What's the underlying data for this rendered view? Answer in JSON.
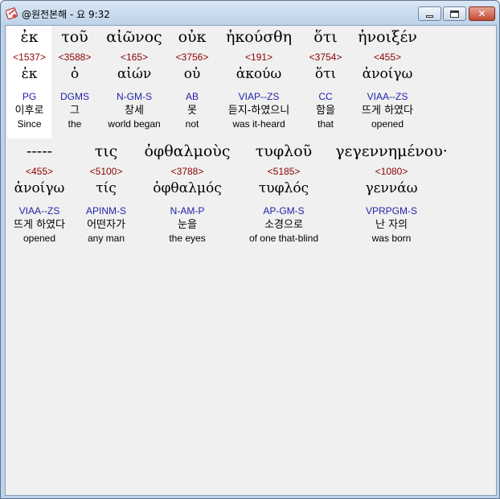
{
  "window": {
    "title": "@원전본해 - 요 9:32",
    "icon": "bible-app-icon",
    "controls": {
      "minimize": "minimize-icon",
      "maximize": "maximize-icon",
      "close": "close-icon",
      "close_glyph": "✕"
    }
  },
  "colors": {
    "strong": "#8b0000",
    "parse": "#2222aa",
    "selected_bg": "#ffffff",
    "client_bg": "#f0f0f0"
  },
  "rows": [
    {
      "words": [
        {
          "greek": "ἐκ",
          "strong": "<1537>",
          "lemma": "ἐκ",
          "parse": "PG",
          "korean": "이후로",
          "english": "Since",
          "selected": true
        },
        {
          "greek": "τοῦ",
          "strong": "<3588>",
          "lemma": "ὁ",
          "parse": "DGMS",
          "korean": "그",
          "english": "the"
        },
        {
          "greek": "αἰῶνος",
          "strong": "<165>",
          "lemma": "αἰών",
          "parse": "N-GM-S",
          "korean": "창세",
          "english": "world began"
        },
        {
          "greek": "οὐκ",
          "strong": "<3756>",
          "lemma": "οὐ",
          "parse": "AB",
          "korean": "못",
          "english": "not"
        },
        {
          "greek": "ἠκούσθη",
          "strong": "<191>",
          "lemma": "ἀκούω",
          "parse": "VIAP--ZS",
          "korean": "듣지-하였으니",
          "english": "was it-heard"
        },
        {
          "greek": "ὅτι",
          "strong": "<3754>",
          "lemma": "ὅτι",
          "parse": "CC",
          "korean": "함을",
          "english": "that"
        },
        {
          "greek": "ἠνοιξέν",
          "strong": "<455>",
          "lemma": "ἀνοίγω",
          "parse": "VIAA--ZS",
          "korean": "뜨게 하였다",
          "english": "opened"
        }
      ]
    },
    {
      "words": [
        {
          "greek": "-----",
          "strong": "<455>",
          "lemma": "ἀνοίγω",
          "parse": "VIAA--ZS",
          "korean": "뜨게 하였다",
          "english": "opened"
        },
        {
          "greek": "τις",
          "strong": "<5100>",
          "lemma": "τίς",
          "parse": "APINM-S",
          "korean": "어떤자가",
          "english": "any man"
        },
        {
          "greek": "ὀφθαλμοὺς",
          "strong": "<3788>",
          "lemma": "ὀφθαλμός",
          "parse": "N-AM-P",
          "korean": "눈을",
          "english": "the eyes"
        },
        {
          "greek": "τυφλοῦ",
          "strong": "<5185>",
          "lemma": "τυφλός",
          "parse": "AP-GM-S",
          "korean": "소경으로",
          "english": "of one that-blind"
        },
        {
          "greek": "γεγεννημένου·",
          "strong": "<1080>",
          "lemma": "γεννάω",
          "parse": "VPRPGM-S",
          "korean": "난 자의",
          "english": "was born"
        }
      ]
    }
  ]
}
